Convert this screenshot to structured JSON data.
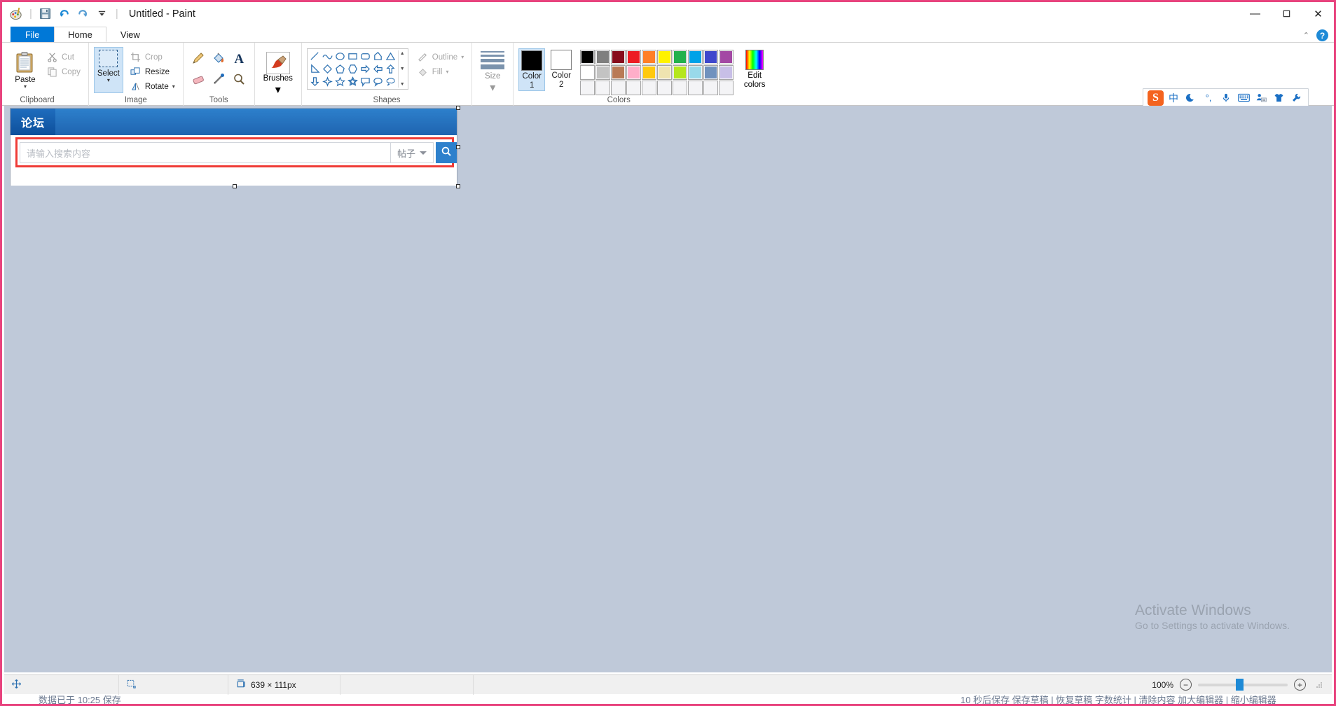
{
  "window": {
    "title": "Untitled - Paint",
    "quick_access": [
      {
        "name": "paint-icon",
        "glyph": "palette"
      },
      {
        "name": "save-icon",
        "glyph": "save"
      },
      {
        "name": "undo-icon",
        "glyph": "undo"
      },
      {
        "name": "redo-icon",
        "glyph": "redo"
      },
      {
        "name": "customize-qat-icon",
        "glyph": "chevron-down"
      }
    ],
    "controls": {
      "minimize": "—",
      "maximize": "☐",
      "close": "✕"
    },
    "ribbon_collapse": "⌃",
    "help": "?"
  },
  "tabs": [
    {
      "label": "File",
      "state": "file"
    },
    {
      "label": "Home",
      "state": "active"
    },
    {
      "label": "View",
      "state": "normal"
    }
  ],
  "ribbon": {
    "clipboard": {
      "label": "Clipboard",
      "paste": {
        "label": "Paste",
        "caret": "▾"
      },
      "cut": {
        "label": "Cut"
      },
      "copy": {
        "label": "Copy"
      }
    },
    "image": {
      "label": "Image",
      "select": {
        "label": "Select",
        "caret": "▾"
      },
      "crop": {
        "label": "Crop"
      },
      "resize": {
        "label": "Resize"
      },
      "rotate": {
        "label": "Rotate",
        "caret": "▾"
      }
    },
    "tools": {
      "label": "Tools",
      "items": [
        "pencil-icon",
        "fill-bucket-icon",
        "text-icon",
        "eraser-icon",
        "color-picker-icon",
        "magnifier-icon"
      ]
    },
    "brushes": {
      "label": "Brushes",
      "caret": "▾"
    },
    "shapes": {
      "label": "Shapes",
      "items": [
        "line",
        "curve",
        "oval",
        "rectangle",
        "rounded-rectangle",
        "polygon",
        "triangle",
        "right-triangle",
        "diamond",
        "pentagon",
        "hexagon",
        "right-arrow",
        "left-arrow",
        "up-arrow",
        "down-arrow",
        "four-point-star",
        "five-point-star",
        "six-point-star",
        "rounded-callout",
        "oval-callout",
        "cloud-callout"
      ],
      "outline": {
        "label": "Outline",
        "caret": "▾"
      },
      "fill": {
        "label": "Fill",
        "caret": "▾"
      }
    },
    "size": {
      "label": "Size",
      "caret": "▾"
    },
    "colors": {
      "label": "Colors",
      "color1": {
        "label_line1": "Color",
        "label_line2": "1",
        "value": "#000000"
      },
      "color2": {
        "label_line1": "Color",
        "label_line2": "2",
        "value": "#ffffff"
      },
      "edit_colors": {
        "label_line1": "Edit",
        "label_line2": "colors"
      },
      "palette_row1": [
        "#000000",
        "#7f7f7f",
        "#870b1c",
        "#ed1c24",
        "#ff7f27",
        "#fff200",
        "#22b14c",
        "#00a2e8",
        "#3f48cc",
        "#a349a4"
      ],
      "palette_row2": [
        "#ffffff",
        "#c3c3c3",
        "#b97a57",
        "#ffaec9",
        "#ffc90e",
        "#efe4b0",
        "#b5e61d",
        "#99d9ea",
        "#7092be",
        "#c8bfe7"
      ],
      "palette_row3": [
        "",
        "",
        "",
        "",
        "",
        "",
        "",
        "",
        "",
        ""
      ]
    }
  },
  "canvas": {
    "forum": {
      "tab_label": "论坛",
      "search_placeholder": "请输入搜索内容",
      "scope_value": "帖子",
      "search_button": "search-icon"
    },
    "highlight_color": "#ef3b36"
  },
  "ime": {
    "logo": "S",
    "items": [
      "中",
      "moon-icon",
      "punctuation-icon",
      "microphone-icon",
      "keyboard-icon",
      "emoji-icon",
      "skin-icon",
      "settings-icon"
    ]
  },
  "watermark": {
    "line1": "Activate Windows",
    "line2": "Go to Settings to activate Windows."
  },
  "statusbar": {
    "cursor_icon": "cursor-position-icon",
    "selection_icon": "selection-size-icon",
    "image_icon": "image-size-icon",
    "image_size": "639 × 111px",
    "zoom_level": "100%",
    "zoom_out": "−",
    "zoom_in": "+"
  },
  "background_text": {
    "left": "数据已于 10:25 保存",
    "right": "10 秒后保存 保存草稿 | 恢复草稿  字数统计 | 清除内容  加大编辑器 | 缩小编辑器"
  }
}
